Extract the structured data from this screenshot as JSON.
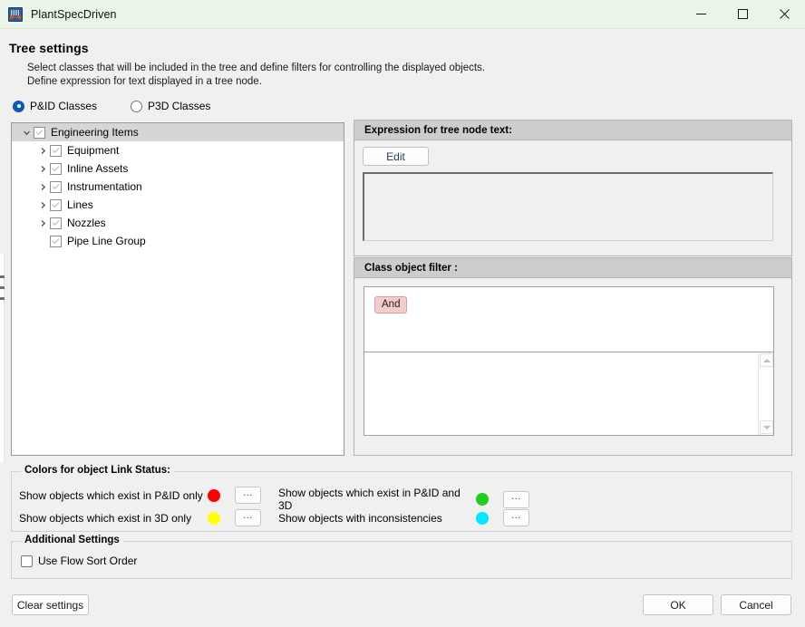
{
  "window": {
    "title": "PlantSpecDriven",
    "icon": "plant-app-icon",
    "caption": {
      "minimize": "minimize-icon",
      "maximize": "maximize-icon",
      "close": "close-icon"
    }
  },
  "page": {
    "heading": "Tree settings",
    "description": "Select classes that will be included in the tree and define filters for controlling the displayed objects.\nDefine expression for text displayed in a tree node."
  },
  "class_mode": {
    "options": [
      {
        "label": "P&ID Classes",
        "selected": true
      },
      {
        "label": "P3D Classes",
        "selected": false
      }
    ]
  },
  "tree": {
    "nodes": [
      {
        "label": "Engineering Items",
        "level": 0,
        "expander": "chevron-down-icon",
        "checked": true,
        "selected": true
      },
      {
        "label": "Equipment",
        "level": 1,
        "expander": "chevron-right-icon",
        "checked": true,
        "selected": false
      },
      {
        "label": "Inline Assets",
        "level": 1,
        "expander": "chevron-right-icon",
        "checked": true,
        "selected": false
      },
      {
        "label": "Instrumentation",
        "level": 1,
        "expander": "chevron-right-icon",
        "checked": true,
        "selected": false
      },
      {
        "label": "Lines",
        "level": 1,
        "expander": "chevron-right-icon",
        "checked": true,
        "selected": false
      },
      {
        "label": "Nozzles",
        "level": 1,
        "expander": "chevron-right-icon",
        "checked": true,
        "selected": false
      },
      {
        "label": "Pipe Line Group",
        "level": 1,
        "expander": "none",
        "checked": true,
        "selected": false
      }
    ]
  },
  "expression_panel": {
    "header": "Expression for tree node text:",
    "edit_button": "Edit",
    "value": ""
  },
  "filter_panel": {
    "header": "Class object filter :",
    "chip": "And",
    "list_value": "",
    "scroll_up": "scroll-up-icon",
    "scroll_down": "scroll-down-icon"
  },
  "colors_group": {
    "legend": "Colors for object Link Status:",
    "rows": [
      {
        "label": "Show objects which exist in P&ID only",
        "color": "#ff0000",
        "button": "..."
      },
      {
        "label": "Show objects which exist in 3D only",
        "color": "#ffff00",
        "button": "..."
      },
      {
        "label": "Show objects which exist in P&ID and 3D",
        "color": "#22cc22",
        "button": "..."
      },
      {
        "label": "Show objects with inconsistencies",
        "color": "#00eaff",
        "button": "..."
      }
    ]
  },
  "additional_settings": {
    "legend": "Additional Settings",
    "checkbox": {
      "label": "Use Flow Sort Order",
      "checked": false
    }
  },
  "footer": {
    "clear": "Clear settings",
    "ok": "OK",
    "cancel": "Cancel"
  }
}
